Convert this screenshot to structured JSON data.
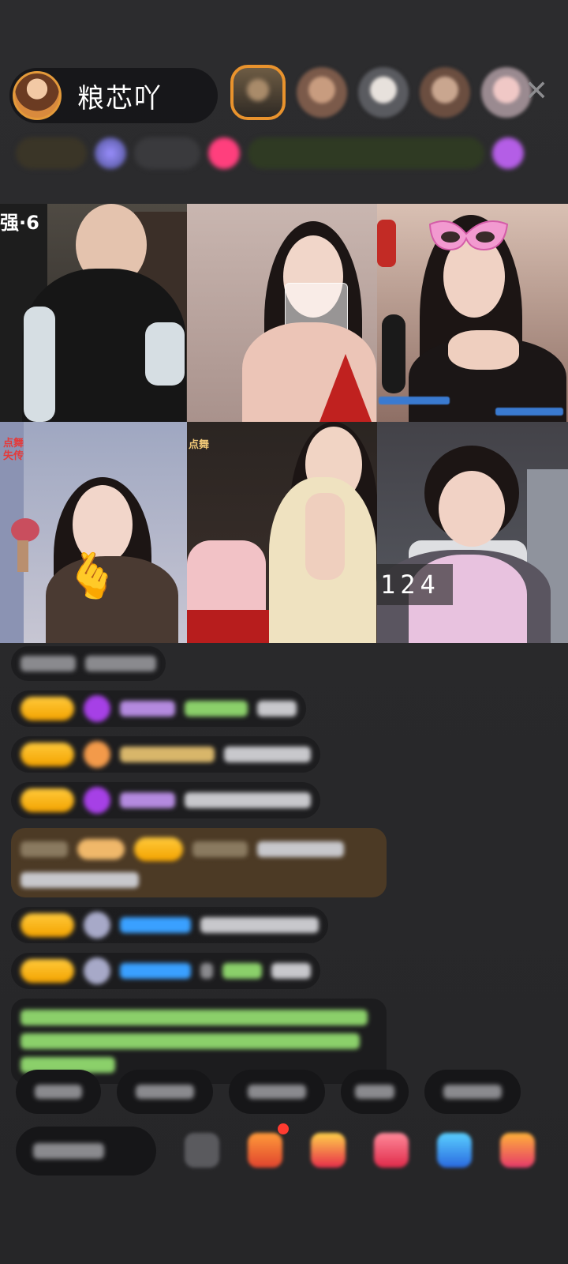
{
  "host": {
    "name": "粮芯吖"
  },
  "grid": {
    "tile1_caption": "强·6",
    "tile4_caption_line1": "点舞",
    "tile4_caption_line2": "失传",
    "tile5_caption": "点舞",
    "tile6_counter": "124"
  },
  "colors": {
    "badge_gold": "#f3a300",
    "gem_purple": "#a640e6",
    "link_blue": "#3aa0ff",
    "green_text": "#8bd06a",
    "close_gray": "#8d8d90"
  },
  "icons": {
    "close": "close-icon",
    "heart_hand": "finger-heart-icon",
    "gift": "gift-icon"
  }
}
